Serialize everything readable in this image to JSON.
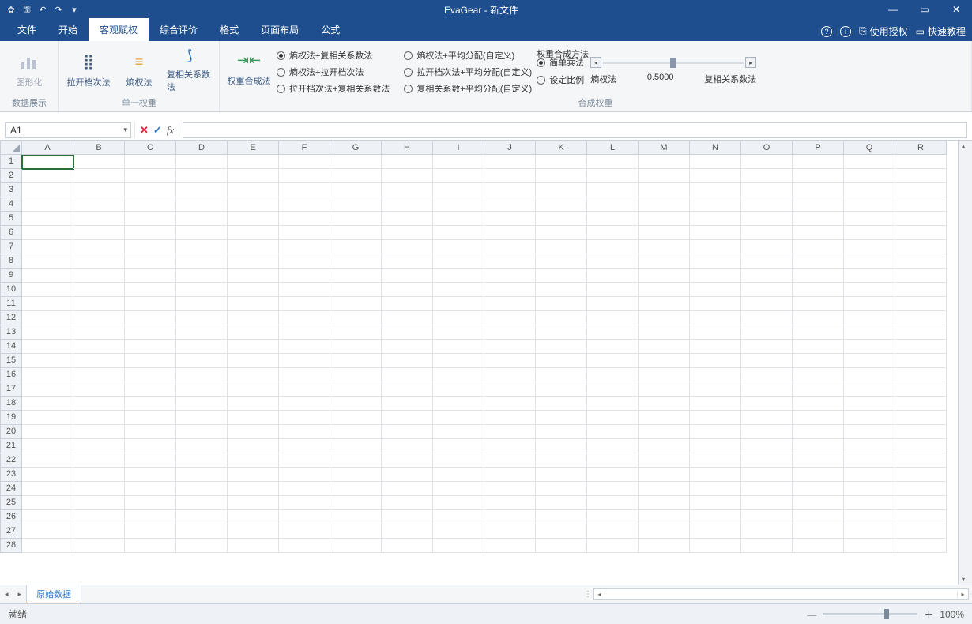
{
  "title": "EvaGear - 新文件",
  "tabs": [
    "文件",
    "开始",
    "客观赋权",
    "综合评价",
    "格式",
    "页面布局",
    "公式"
  ],
  "active_tab": 2,
  "titlebar_right": {
    "license": "使用授权",
    "tutorial": "快速教程"
  },
  "ribbon": {
    "group1": {
      "caption": "数据展示",
      "btn": "图形化"
    },
    "group2": {
      "caption": "单一权重",
      "btns": [
        "拉开档次法",
        "熵权法",
        "复相关系数法"
      ]
    },
    "group3_btn": "权重合成法",
    "group3_caption": "合成权重",
    "radios_col1": [
      "熵权法+复相关系数法",
      "熵权法+拉开档次法",
      "拉开档次法+复相关系数法"
    ],
    "radios_col2": [
      "熵权法+平均分配(自定义)",
      "拉开档次法+平均分配(自定义)",
      "复相关系数+平均分配(自定义)"
    ],
    "weight_hdr": "权重合成方法",
    "weight_radios": [
      "简单乘法",
      "设定比例"
    ],
    "weight_left": "熵权法",
    "weight_val": "0.5000",
    "weight_right": "复相关系数法"
  },
  "cell_ref": "A1",
  "columns": [
    "A",
    "B",
    "C",
    "D",
    "E",
    "F",
    "G",
    "H",
    "I",
    "J",
    "K",
    "L",
    "M",
    "N",
    "O",
    "P",
    "Q",
    "R"
  ],
  "row_count": 28,
  "sheet_tab": "原始数据",
  "status": "就绪",
  "zoom": "100%"
}
